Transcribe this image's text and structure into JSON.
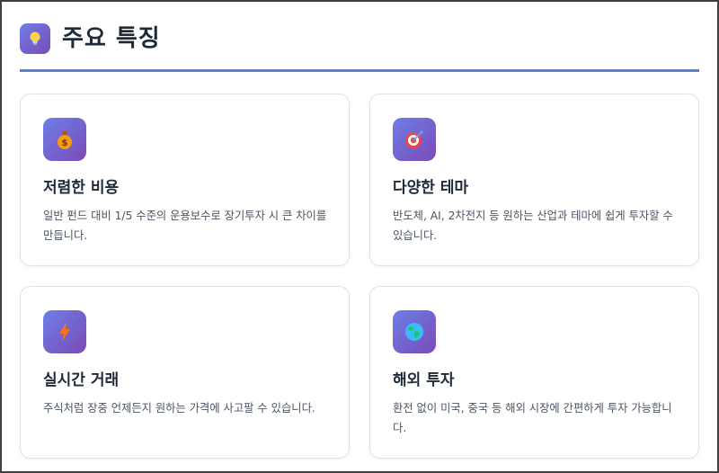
{
  "section": {
    "title": "주요 특징",
    "icon": "lightbulb-icon"
  },
  "features": [
    {
      "icon": "money-bag-icon",
      "title": "저렴한 비용",
      "description": "일반 펀드 대비 1/5 수준의 운용보수로 장기투자 시 큰 차이를 만듭니다."
    },
    {
      "icon": "target-icon",
      "title": "다양한 테마",
      "description": "반도체, AI, 2차전지 등 원하는 산업과 테마에 쉽게 투자할 수 있습니다."
    },
    {
      "icon": "lightning-icon",
      "title": "실시간 거래",
      "description": "주식처럼 장중 언제든지 원하는 가격에 사고팔 수 있습니다."
    },
    {
      "icon": "globe-icon",
      "title": "해외 투자",
      "description": "환전 없이 미국, 중국 등 해외 시장에 간편하게 투자 가능합니다."
    }
  ],
  "colors": {
    "accent": "#5b7fd6",
    "icon_gradient_start": "#6d7ee8",
    "icon_gradient_end": "#7b4bb5",
    "card_border": "#dde3ec",
    "title_text": "#1f2937",
    "body_text": "#4b5563"
  }
}
